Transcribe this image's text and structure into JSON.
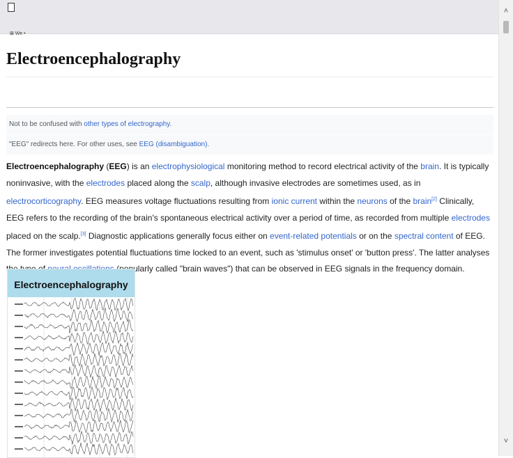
{
  "window": {
    "stub_text": "⊠ We •"
  },
  "article": {
    "title": "Electroencephalography",
    "hatnotes": [
      {
        "prefix": "Not to be confused with ",
        "link": "other types of electrography",
        "suffix": "."
      },
      {
        "prefix": "\"EEG\" redirects here. For other uses, see ",
        "link": "EEG (disambiguation)",
        "suffix": "."
      }
    ],
    "lead": {
      "term": "Electroencephalography",
      "open": " (",
      "abbr": "EEG",
      "t1": ") is an ",
      "l1": "electrophysiological",
      "t2": " monitoring method to record electrical activity of the ",
      "l2": "brain",
      "t3": ". It is typically noninvasive, with the ",
      "l3": "electrodes",
      "t4": " placed along the ",
      "l4": "scalp",
      "t5": ", although invasive electrodes are sometimes used, as in ",
      "l5": "electrocorticography",
      "t6": ". EEG measures voltage fluctuations resulting from ",
      "l6": "ionic current",
      "t7": " within the ",
      "l7": "neurons",
      "t8": " of the ",
      "l8": "brain",
      "r1": "[2]",
      "t9": " Clinically, EEG refers to the recording of the brain's spontaneous electrical activity over a period of time, as recorded from multiple ",
      "l9": "electrodes",
      "t10": " placed on the scalp.",
      "r2": "[3]",
      "t11": " Diagnostic applications generally focus either on ",
      "l10": "event-related potentials",
      "t12": " or on the ",
      "l11": "spectral content",
      "t13": " of EEG. The former investigates potential fluctuations time locked to an event, such as 'stimulus onset' or 'button press'. The latter analyses the type of ",
      "l12": "neural oscillations",
      "t14": " (popularly called \"brain waves\") that can be observed in EEG signals in the frequency domain."
    },
    "infobox": {
      "title": "Electroencephalography"
    }
  }
}
